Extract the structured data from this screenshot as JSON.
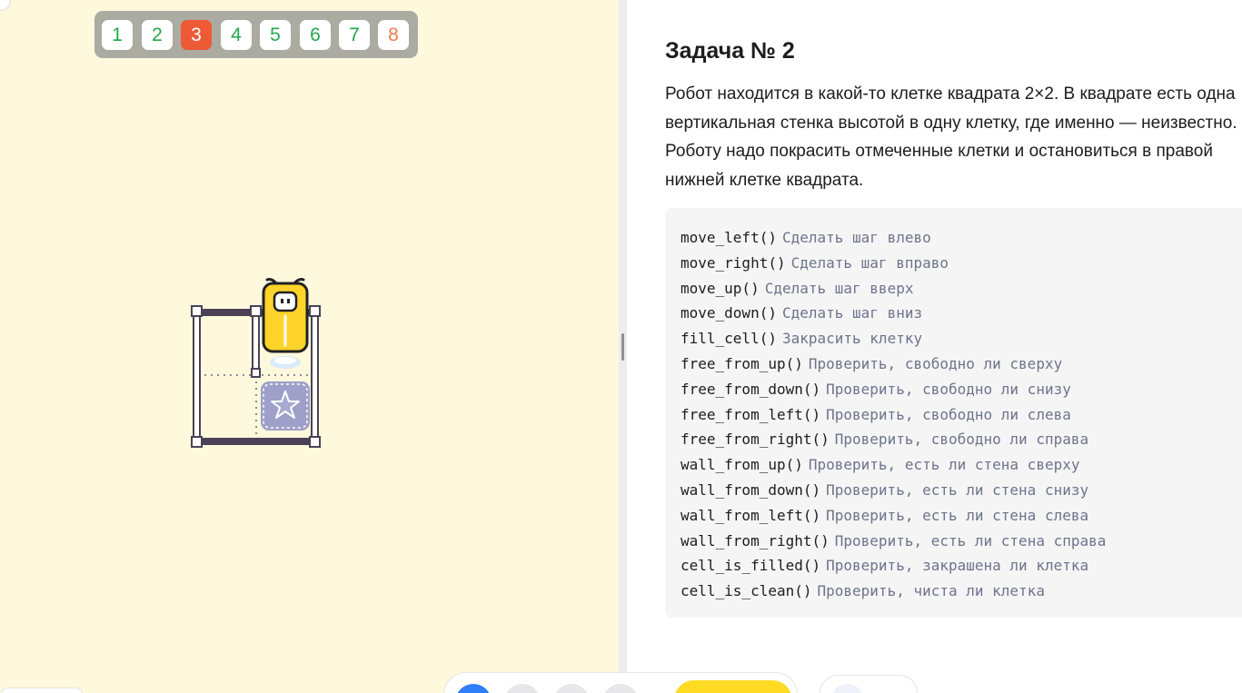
{
  "levels": {
    "items": [
      {
        "label": "1",
        "state": "done"
      },
      {
        "label": "2",
        "state": "done"
      },
      {
        "label": "3",
        "state": "active"
      },
      {
        "label": "4",
        "state": "done"
      },
      {
        "label": "5",
        "state": "done"
      },
      {
        "label": "6",
        "state": "done"
      },
      {
        "label": "7",
        "state": "done"
      },
      {
        "label": "8",
        "state": "locked"
      }
    ]
  },
  "field": {
    "rows": 2,
    "cols": 2,
    "robot": {
      "row": 0,
      "col": 1
    },
    "marked_cells": [
      {
        "row": 1,
        "col": 1
      }
    ],
    "walls": [
      "vertical wall between top-left and top-right cells"
    ]
  },
  "task": {
    "title": "Задача № 2",
    "description": [
      "Робот находится в какой-то клетке квадрата 2×2. В квадрате есть одна",
      "вертикальная стенка высотой в одну клетку, где именно — неизвестно.",
      "Роботу надо покрасить отмеченные клетки и остановиться в правой",
      "нижней клетке квадрата."
    ]
  },
  "commands": [
    {
      "fn": "move_left()",
      "desc": "Сделать шаг влево"
    },
    {
      "fn": "move_right()",
      "desc": "Сделать шаг вправо"
    },
    {
      "fn": "move_up()",
      "desc": "Сделать шаг вверх"
    },
    {
      "fn": "move_down()",
      "desc": "Сделать шаг вниз"
    },
    {
      "fn": "fill_cell()",
      "desc": "Закрасить клетку"
    },
    {
      "fn": "free_from_up()",
      "desc": "Проверить, свободно ли сверху"
    },
    {
      "fn": "free_from_down()",
      "desc": "Проверить, свободно ли снизу"
    },
    {
      "fn": "free_from_left()",
      "desc": "Проверить, свободно ли слева"
    },
    {
      "fn": "free_from_right()",
      "desc": "Проверить, свободно ли справа"
    },
    {
      "fn": "wall_from_up()",
      "desc": "Проверить, есть ли стена сверху"
    },
    {
      "fn": "wall_from_down()",
      "desc": "Проверить, есть ли стена снизу"
    },
    {
      "fn": "wall_from_left()",
      "desc": "Проверить, есть ли стена слева"
    },
    {
      "fn": "wall_from_right()",
      "desc": "Проверить, есть ли стена справа"
    },
    {
      "fn": "cell_is_filled()",
      "desc": "Проверить, закрашена ли клетка"
    },
    {
      "fn": "cell_is_clean()",
      "desc": "Проверить, чиста ли клетка"
    }
  ],
  "colors": {
    "left_bg": "#fef8dc",
    "level_done": "#21a84a",
    "level_active": "#ee5a36",
    "robot": "#ffd42a",
    "wall": "#4b4257",
    "marked_cell": "#9ea0c9",
    "run_button": "#ffdb24"
  }
}
